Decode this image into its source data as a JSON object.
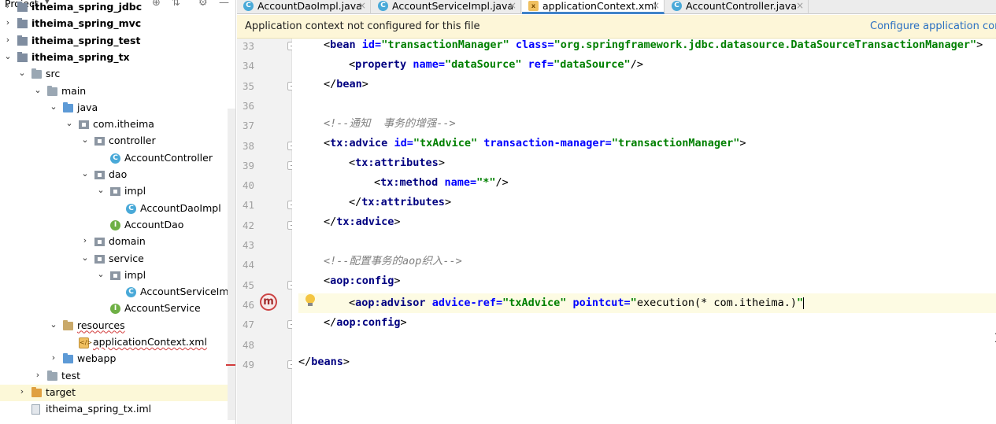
{
  "project_panel": {
    "title": "Project",
    "tree": [
      {
        "label": "itheima_spring_jdbc",
        "type": "module",
        "arrow": "collapsed",
        "bold": true
      },
      {
        "label": "itheima_spring_mvc",
        "type": "module",
        "arrow": "collapsed",
        "bold": true
      },
      {
        "label": "itheima_spring_test",
        "type": "module",
        "arrow": "collapsed",
        "bold": true
      },
      {
        "label": "itheima_spring_tx",
        "type": "module",
        "arrow": "expanded",
        "bold": true
      },
      {
        "label": "src",
        "type": "folder",
        "arrow": "expanded"
      },
      {
        "label": "main",
        "type": "folder",
        "arrow": "expanded"
      },
      {
        "label": "java",
        "type": "folder-blue",
        "arrow": "expanded"
      },
      {
        "label": "com.itheima",
        "type": "package",
        "arrow": "expanded"
      },
      {
        "label": "controller",
        "type": "package",
        "arrow": "expanded"
      },
      {
        "label": "AccountController",
        "type": "class",
        "arrow": ""
      },
      {
        "label": "dao",
        "type": "package",
        "arrow": "expanded"
      },
      {
        "label": "impl",
        "type": "package",
        "arrow": "expanded"
      },
      {
        "label": "AccountDaoImpl",
        "type": "class",
        "arrow": ""
      },
      {
        "label": "AccountDao",
        "type": "interface",
        "arrow": ""
      },
      {
        "label": "domain",
        "type": "package",
        "arrow": "collapsed"
      },
      {
        "label": "service",
        "type": "package",
        "arrow": "expanded"
      },
      {
        "label": "impl",
        "type": "package",
        "arrow": "expanded"
      },
      {
        "label": "AccountServiceImpl",
        "type": "class",
        "arrow": ""
      },
      {
        "label": "AccountService",
        "type": "interface",
        "arrow": ""
      },
      {
        "label": "resources",
        "type": "folder-res",
        "arrow": "expanded",
        "error": true
      },
      {
        "label": "applicationContext.xml",
        "type": "xml",
        "arrow": "",
        "error": true
      },
      {
        "label": "webapp",
        "type": "folder-blue",
        "arrow": "collapsed"
      },
      {
        "label": "test",
        "type": "folder",
        "arrow": "collapsed"
      },
      {
        "label": "target",
        "type": "folder-orange",
        "arrow": "collapsed",
        "selected": true
      },
      {
        "label": "itheima_spring_tx.iml",
        "type": "iml",
        "arrow": ""
      }
    ]
  },
  "tabs": [
    {
      "label": "AccountDaoImpl.java",
      "icon": "class-icon",
      "active": false
    },
    {
      "label": "AccountServiceImpl.java",
      "icon": "class-icon",
      "active": false
    },
    {
      "label": "applicationContext.xml",
      "icon": "xml-icon",
      "active": true
    },
    {
      "label": "AccountController.java",
      "icon": "class-icon",
      "active": false
    }
  ],
  "banner": {
    "message": "Application context not configured for this file",
    "link": "Configure application conte"
  },
  "editor": {
    "line_numbers": [
      "33",
      "34",
      "35",
      "36",
      "37",
      "38",
      "39",
      "40",
      "41",
      "42",
      "43",
      "44",
      "45",
      "46",
      "47",
      "48",
      "49"
    ],
    "current_line": "46",
    "breakpoint_label": "m"
  }
}
